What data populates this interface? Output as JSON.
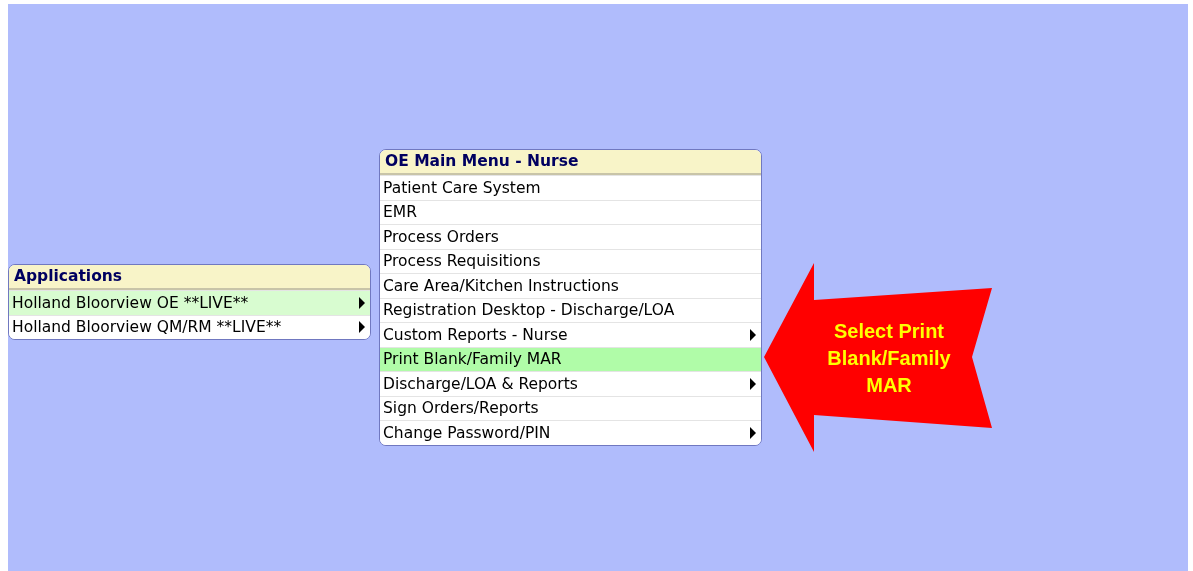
{
  "menus": [
    {
      "title": "Applications",
      "items": [
        {
          "label": "Holland Bloorview OE **LIVE**",
          "selected": true,
          "has_submenu": true
        },
        {
          "label": "Holland Bloorview QM/RM **LIVE**",
          "selected": false,
          "has_submenu": true
        }
      ]
    },
    {
      "title": "OE Main Menu - Nurse",
      "items": [
        {
          "label": "Patient Care System",
          "selected": false,
          "has_submenu": false
        },
        {
          "label": "EMR",
          "selected": false,
          "has_submenu": false
        },
        {
          "label": "Process Orders",
          "selected": false,
          "has_submenu": false
        },
        {
          "label": "Process Requisitions",
          "selected": false,
          "has_submenu": false
        },
        {
          "label": "Care Area/Kitchen Instructions",
          "selected": false,
          "has_submenu": false
        },
        {
          "label": "Registration Desktop - Discharge/LOA",
          "selected": false,
          "has_submenu": false
        },
        {
          "label": "Custom Reports - Nurse",
          "selected": false,
          "has_submenu": true
        },
        {
          "label": "Print Blank/Family MAR",
          "selected": true,
          "has_submenu": false
        },
        {
          "label": "Discharge/LOA & Reports",
          "selected": false,
          "has_submenu": true
        },
        {
          "label": "Sign Orders/Reports",
          "selected": false,
          "has_submenu": false
        },
        {
          "label": "Change Password/PIN",
          "selected": false,
          "has_submenu": true
        }
      ]
    }
  ],
  "callout": {
    "lines": [
      "Select Print",
      "Blank/Family",
      "MAR"
    ]
  }
}
